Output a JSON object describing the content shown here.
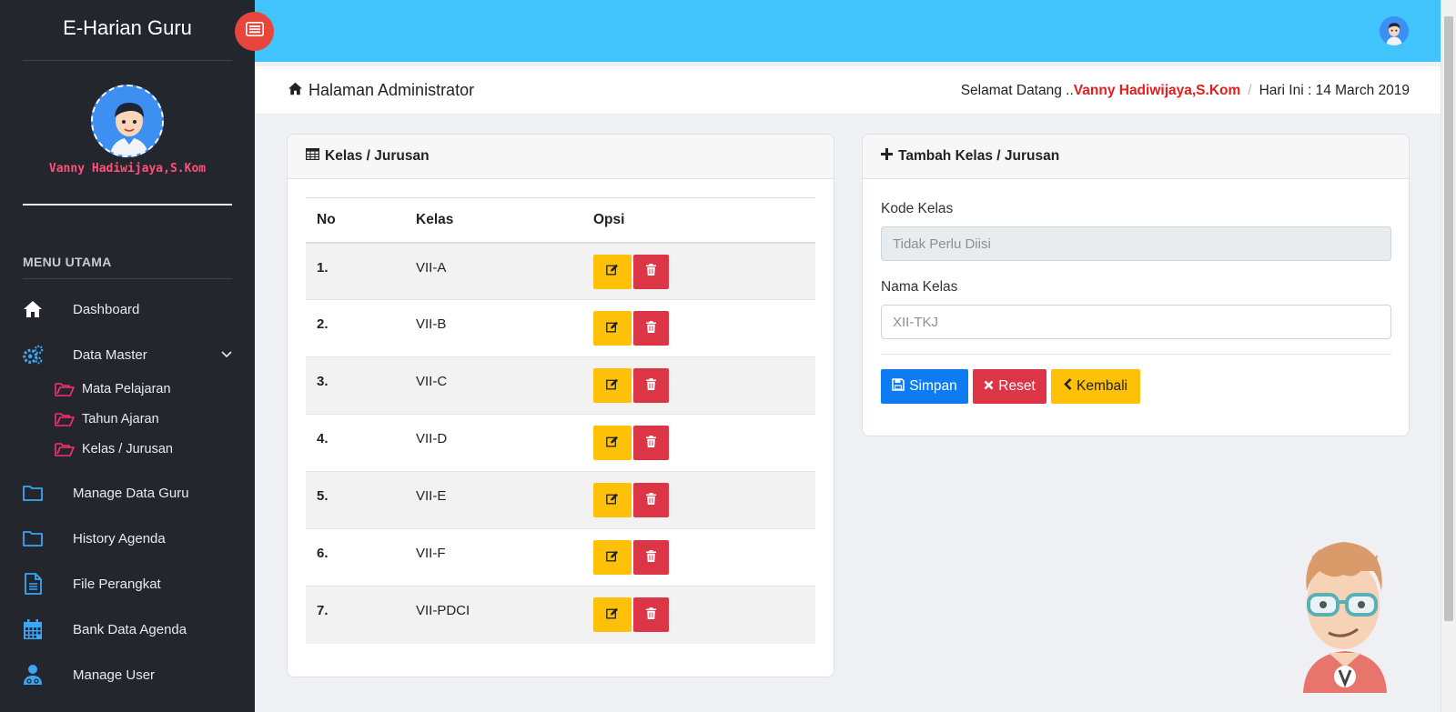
{
  "app": {
    "title": "E-Harian Guru"
  },
  "profile": {
    "name": "Vanny Hadiwijaya,S.Kom"
  },
  "sidebar": {
    "menu_title": "MENU UTAMA",
    "items": [
      {
        "label": "Dashboard",
        "icon": "home-icon"
      },
      {
        "label": "Data Master",
        "icon": "gears-icon"
      },
      {
        "label": "Manage Data Guru",
        "icon": "folder-icon"
      },
      {
        "label": "History Agenda",
        "icon": "folder-icon"
      },
      {
        "label": "File Perangkat",
        "icon": "file-text-icon"
      },
      {
        "label": "Bank Data Agenda",
        "icon": "calendar-icon"
      },
      {
        "label": "Manage User",
        "icon": "user-md-icon"
      }
    ],
    "sub_items": [
      {
        "label": "Mata Pelajaran",
        "icon": "folder-open-icon"
      },
      {
        "label": "Tahun Ajaran",
        "icon": "folder-open-icon"
      },
      {
        "label": "Kelas / Jurusan",
        "icon": "folder-open-icon"
      }
    ]
  },
  "breadcrumb": {
    "title": "Halaman Administrator",
    "welcome": "Selamat Datang ..",
    "user": "Vanny Hadiwijaya,S.Kom",
    "separator": "/",
    "date": "Hari Ini : 14 March 2019"
  },
  "table_card": {
    "title": "Kelas / Jurusan",
    "columns": [
      "No",
      "Kelas",
      "Opsi"
    ],
    "rows": [
      {
        "no": "1.",
        "kelas": "VII-A"
      },
      {
        "no": "2.",
        "kelas": "VII-B"
      },
      {
        "no": "3.",
        "kelas": "VII-C"
      },
      {
        "no": "4.",
        "kelas": "VII-D"
      },
      {
        "no": "5.",
        "kelas": "VII-E"
      },
      {
        "no": "6.",
        "kelas": "VII-F"
      },
      {
        "no": "7.",
        "kelas": "VII-PDCI"
      }
    ]
  },
  "form_card": {
    "title": "Tambah Kelas / Jurusan",
    "kode_label": "Kode Kelas",
    "kode_placeholder": "Tidak Perlu Diisi",
    "nama_label": "Nama Kelas",
    "nama_placeholder": "XII-TKJ",
    "save_label": "Simpan",
    "reset_label": "Reset",
    "back_label": "Kembali"
  },
  "colors": {
    "sidebar": "#23272d",
    "topbar": "#41c3fb",
    "accent_pink": "#ff4f7b",
    "warning": "#ffc107",
    "danger": "#dc3545",
    "primary": "#0d7bf2"
  }
}
